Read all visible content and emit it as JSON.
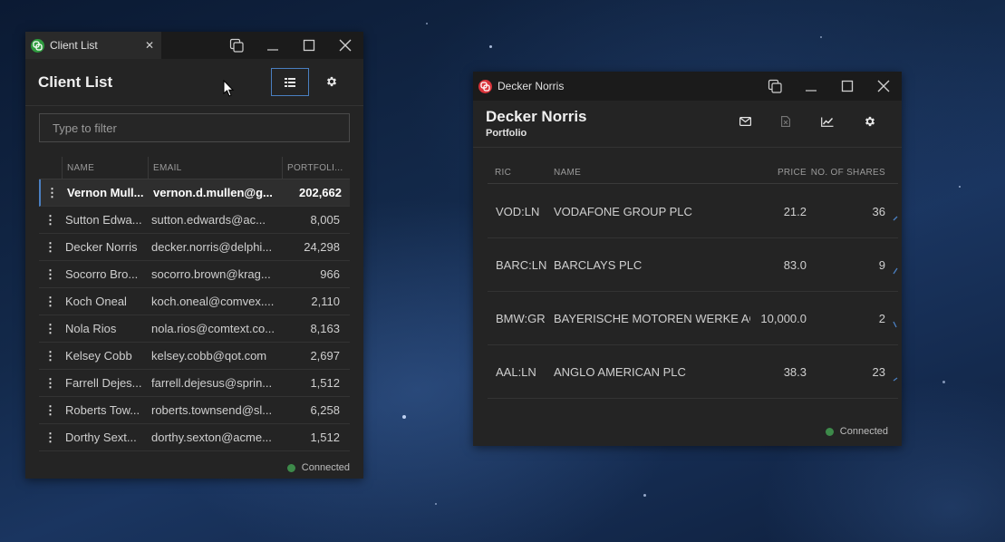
{
  "client_window": {
    "tab_title": "Client List",
    "title": "Client List",
    "filter_placeholder": "Type to filter",
    "columns": [
      "NAME",
      "EMAIL",
      "PORTFOLI..."
    ],
    "rows": [
      {
        "name": "Vernon Mull...",
        "email": "vernon.d.mullen@g...",
        "portfolio": "202,662",
        "selected": true
      },
      {
        "name": "Sutton Edwa...",
        "email": "sutton.edwards@ac...",
        "portfolio": "8,005"
      },
      {
        "name": "Decker Norris",
        "email": "decker.norris@delphi...",
        "portfolio": "24,298"
      },
      {
        "name": "Socorro Bro...",
        "email": "socorro.brown@krag...",
        "portfolio": "966"
      },
      {
        "name": "Koch Oneal",
        "email": "koch.oneal@comvex....",
        "portfolio": "2,110"
      },
      {
        "name": "Nola Rios",
        "email": "nola.rios@comtext.co...",
        "portfolio": "8,163"
      },
      {
        "name": "Kelsey Cobb",
        "email": "kelsey.cobb@qot.com",
        "portfolio": "2,697"
      },
      {
        "name": "Farrell Dejes...",
        "email": "farrell.dejesus@sprin...",
        "portfolio": "1,512"
      },
      {
        "name": "Roberts Tow...",
        "email": "roberts.townsend@sl...",
        "portfolio": "6,258"
      },
      {
        "name": "Dorthy Sext...",
        "email": "dorthy.sexton@acme...",
        "portfolio": "1,512"
      }
    ],
    "status": "Connected"
  },
  "portfolio_window": {
    "title": "Decker Norris",
    "name": "Decker Norris",
    "subtitle": "Portfolio",
    "columns": {
      "ric": "RIC",
      "name": "NAME",
      "price": "PRICE",
      "shares": "NO. OF SHARES"
    },
    "rows": [
      {
        "ric": "VOD:LN",
        "name": "VODAFONE GROUP PLC",
        "price": "21.2",
        "shares": "36"
      },
      {
        "ric": "BARC:LN",
        "name": "BARCLAYS PLC",
        "price": "83.0",
        "shares": "9"
      },
      {
        "ric": "BMW:GR",
        "name": "BAYERISCHE MOTOREN WERKE AG",
        "price": "10,000.0",
        "shares": "2"
      },
      {
        "ric": "AAL:LN",
        "name": "ANGLO AMERICAN PLC",
        "price": "38.3",
        "shares": "23"
      }
    ],
    "status": "Connected"
  },
  "colors": {
    "accent": "#4a7fc1",
    "client_logo": "#2e9b3e",
    "portfolio_logo": "#d9333a",
    "connected": "#3d8a4a"
  },
  "icons": [
    "app-logo-icon",
    "close-icon",
    "popout-icon",
    "minimize-icon",
    "maximize-icon",
    "list-view-icon",
    "gear-icon",
    "kebab-menu-icon",
    "mail-icon",
    "export-icon",
    "chart-icon",
    "mouse-cursor-icon"
  ]
}
